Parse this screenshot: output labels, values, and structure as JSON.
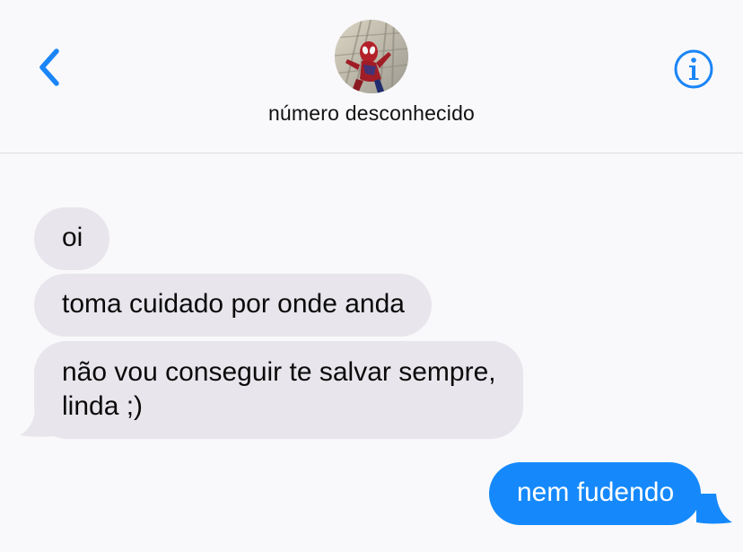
{
  "header": {
    "back_icon": "chevron-left-icon",
    "info_icon": "info-circle-icon",
    "avatar_icon": "contact-avatar-spiderman",
    "contact_name": "número desconhecido",
    "accent_color": "#1a85f7"
  },
  "messages": [
    {
      "direction": "incoming",
      "text": "oi"
    },
    {
      "direction": "incoming",
      "text": "toma cuidado por onde anda"
    },
    {
      "direction": "incoming",
      "line1": "não vou conseguir te salvar sempre,",
      "line2": "linda ;)"
    },
    {
      "direction": "outgoing",
      "text": "nem fudendo"
    }
  ],
  "colors": {
    "incoming_bubble": "#e8e6ec",
    "outgoing_bubble": "#1589fb",
    "background": "#f9f9fb"
  }
}
